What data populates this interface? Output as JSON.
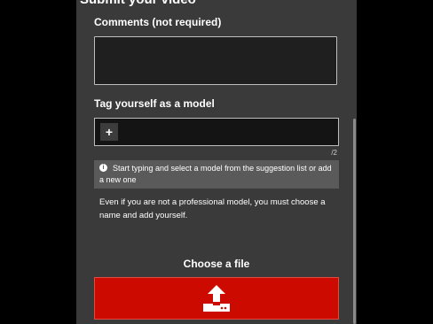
{
  "form": {
    "title": "Submit your video",
    "comments_label": "Comments (not required)",
    "comments_value": "",
    "tag_label": "Tag yourself as a model",
    "tag_add_label": "+",
    "tag_counter": "/2",
    "info_text": "Start typing and select a model from the suggestion list or add a new one",
    "note_text": "Even if you are not a professional model, you must choose a name and add yourself.",
    "choose_file_label": "Choose a file"
  },
  "icons": {
    "info": "info-icon",
    "upload": "upload-icon"
  },
  "colors": {
    "panel_bg": "#3a3a3a",
    "upload_button": "#cc0a00",
    "info_bar": "#5a5a5a"
  }
}
